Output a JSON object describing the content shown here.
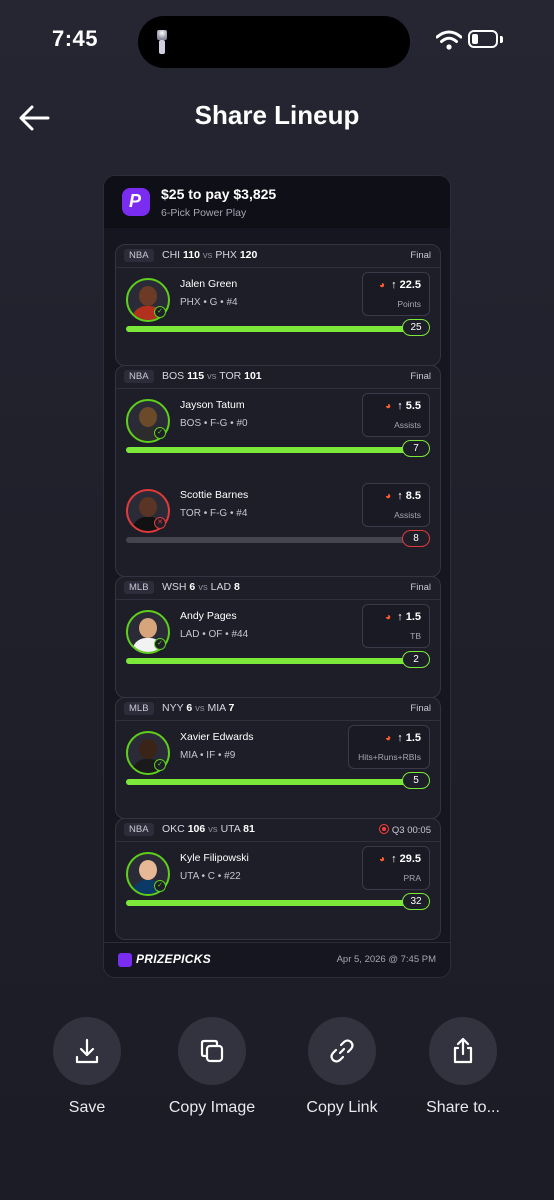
{
  "status_bar": {
    "time": "7:45"
  },
  "header": {
    "title": "Share Lineup"
  },
  "card": {
    "payout": "$25 to pay $3,825",
    "subtitle": "6-Pick Power Play",
    "logo_letter": "P",
    "games": [
      {
        "league": "NBA",
        "team1": "CHI",
        "score1": "110",
        "vs": "vs",
        "team2": "PHX",
        "score2": "120",
        "status": "Final",
        "live": false,
        "picks": [
          {
            "name": "Jalen Green",
            "info": "PHX • G • #4",
            "line": "22.5",
            "stat": "Points",
            "result": "25",
            "hit": true,
            "progress": 1.0
          }
        ]
      },
      {
        "league": "NBA",
        "team1": "BOS",
        "score1": "115",
        "vs": "vs",
        "team2": "TOR",
        "score2": "101",
        "status": "Final",
        "live": false,
        "picks": [
          {
            "name": "Jayson Tatum",
            "info": "BOS • F-G • #0",
            "line": "5.5",
            "stat": "Assists",
            "result": "7",
            "hit": true,
            "progress": 1.0
          },
          {
            "name": "Scottie Barnes",
            "info": "TOR • F-G • #4",
            "line": "8.5",
            "stat": "Assists",
            "result": "8",
            "hit": false,
            "progress": 0.94
          }
        ]
      },
      {
        "league": "MLB",
        "team1": "WSH",
        "score1": "6",
        "vs": "vs",
        "team2": "LAD",
        "score2": "8",
        "status": "Final",
        "live": false,
        "picks": [
          {
            "name": "Andy Pages",
            "info": "LAD • OF • #44",
            "line": "1.5",
            "stat": "TB",
            "result": "2",
            "hit": true,
            "progress": 1.0
          }
        ]
      },
      {
        "league": "MLB",
        "team1": "NYY",
        "score1": "6",
        "vs": "vs",
        "team2": "MIA",
        "score2": "7",
        "status": "Final",
        "live": false,
        "picks": [
          {
            "name": "Xavier Edwards",
            "info": "MIA • IF • #9",
            "line": "1.5",
            "stat": "Hits+Runs+RBIs",
            "result": "5",
            "hit": true,
            "progress": 1.0
          }
        ]
      },
      {
        "league": "NBA",
        "team1": "OKC",
        "score1": "106",
        "vs": "vs",
        "team2": "UTA",
        "score2": "81",
        "status": "Q3 00:05",
        "live": true,
        "picks": [
          {
            "name": "Kyle Filipowski",
            "info": "UTA • C • #22",
            "line": "29.5",
            "stat": "PRA",
            "result": "32",
            "hit": true,
            "progress": 1.0
          }
        ]
      }
    ],
    "footer": {
      "brand": "PRIZEPICKS",
      "date": "Apr 5, 2026 @ 7:45 PM"
    }
  },
  "actions": [
    {
      "label": "Save",
      "icon": "download-icon"
    },
    {
      "label": "Copy Image",
      "icon": "copy-icon"
    },
    {
      "label": "Copy Link",
      "icon": "link-icon"
    },
    {
      "label": "Share to...",
      "icon": "share-icon"
    }
  ],
  "colors": {
    "hit": "#7be83a",
    "miss": "#e23a3a",
    "brand": "#7a2cf0"
  }
}
